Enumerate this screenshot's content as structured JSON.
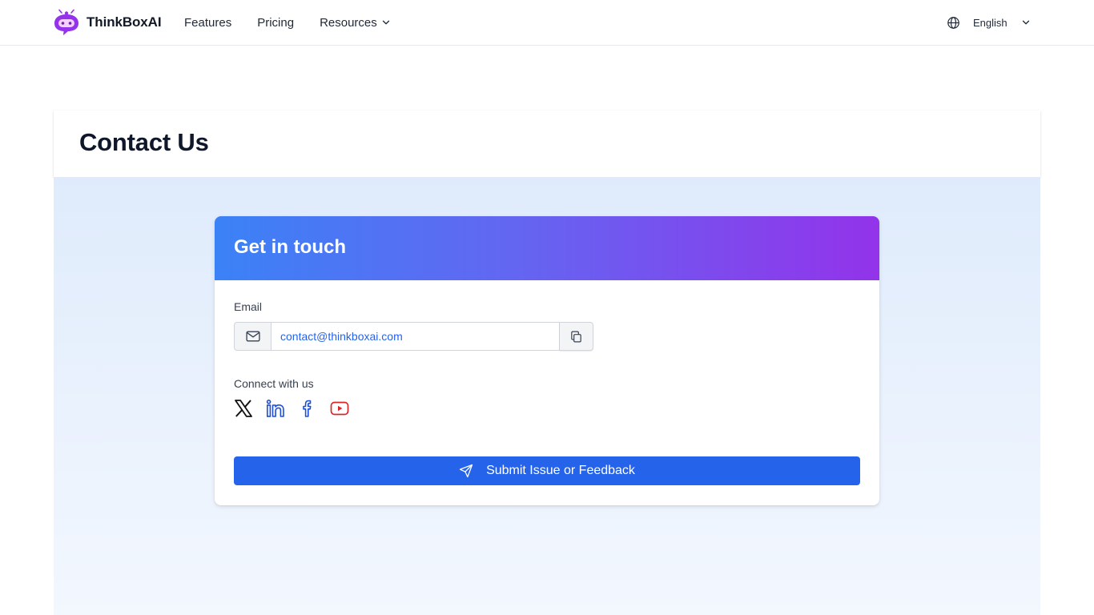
{
  "nav": {
    "brand": "ThinkBoxAI",
    "links": [
      {
        "label": "Features"
      },
      {
        "label": "Pricing"
      },
      {
        "label": "Resources"
      }
    ],
    "language": "English"
  },
  "page": {
    "title": "Contact Us"
  },
  "card": {
    "title": "Get in touch",
    "email_label": "Email",
    "email_value": "contact@thinkboxai.com",
    "connect_label": "Connect with us",
    "socials": [
      "x-icon",
      "linkedin-icon",
      "facebook-icon",
      "youtube-icon"
    ],
    "submit_label": "Submit Issue or Feedback"
  },
  "colors": {
    "brand_purple": "#9333ea",
    "primary_blue": "#2563eb",
    "gradient_start": "#3b82f6",
    "gradient_end": "#9333ea",
    "youtube_red": "#dc2626",
    "social_blue": "#1d4ed8"
  }
}
